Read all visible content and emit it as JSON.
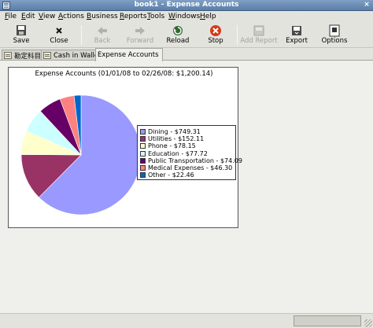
{
  "window": {
    "title": "book1 - Expense Accounts",
    "close_glyph": "×"
  },
  "menu": [
    "File",
    "Edit",
    "View",
    "Actions",
    "Business",
    "Reports",
    "Tools",
    "Windows",
    "Help"
  ],
  "toolbar": {
    "save": "Save",
    "close": "Close",
    "back": "Back",
    "forward": "Forward",
    "reload": "Reload",
    "stop": "Stop",
    "add_report": "Add Report",
    "export": "Export",
    "options": "Options"
  },
  "tabs": [
    {
      "label": "勘定科目",
      "icon": "ledger-icon"
    },
    {
      "label": "Cash in Wallet",
      "icon": "ledger-icon"
    },
    {
      "label": "Expense Accounts",
      "icon": ""
    }
  ],
  "chart_data": {
    "type": "pie",
    "title": "Expense Accounts (01/01/08 to 02/26/08: $1,200.14)",
    "categories": [
      "Dining",
      "Utilities",
      "Phone",
      "Education",
      "Public Transportation",
      "Medical Expenses",
      "Other"
    ],
    "values": [
      749.31,
      152.11,
      78.15,
      77.72,
      74.09,
      46.3,
      22.46
    ],
    "labels": [
      "Dining - $749.31",
      "Utilities - $152.11",
      "Phone - $78.15",
      "Education - $77.72",
      "Public Transportation - $74.09",
      "Medical Expenses - $46.30",
      "Other - $22.46"
    ],
    "colors": [
      "#9999ff",
      "#993366",
      "#ffffcc",
      "#ccffff",
      "#660066",
      "#ff8080",
      "#0066cc"
    ],
    "legend_position": "right"
  }
}
